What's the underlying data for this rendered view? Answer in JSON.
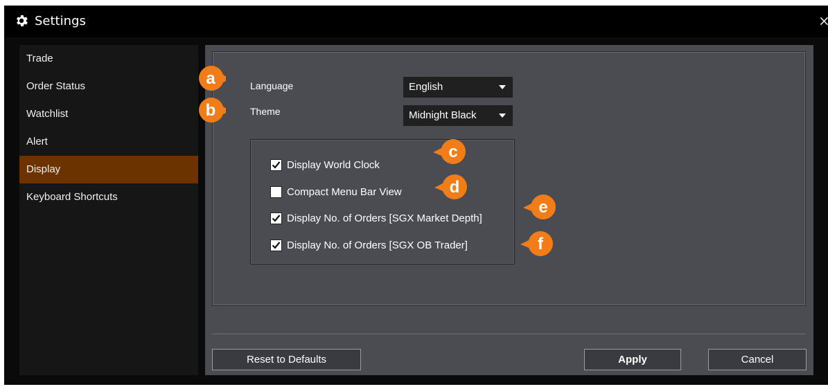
{
  "window": {
    "title": "Settings",
    "close_glyph": "×"
  },
  "sidebar": {
    "items": [
      {
        "label": "Trade"
      },
      {
        "label": "Order Status"
      },
      {
        "label": "Watchlist"
      },
      {
        "label": "Alert"
      },
      {
        "label": "Display",
        "active": true
      },
      {
        "label": "Keyboard Shortcuts"
      }
    ]
  },
  "display": {
    "language": {
      "label": "Language",
      "value": "English"
    },
    "theme": {
      "label": "Theme",
      "value": "Midnight Black"
    },
    "options": [
      {
        "label": "Display World Clock",
        "checked": true
      },
      {
        "label": "Compact Menu Bar View",
        "checked": false
      },
      {
        "label": "Display No. of Orders [SGX Market Depth]",
        "checked": true
      },
      {
        "label": "Display No. of Orders [SGX OB Trader]",
        "checked": true
      }
    ]
  },
  "buttons": {
    "reset": "Reset to Defaults",
    "apply": "Apply",
    "cancel": "Cancel"
  },
  "callouts": [
    "a",
    "b",
    "c",
    "d",
    "e",
    "f"
  ],
  "colors": {
    "accent_orange": "#f07d18",
    "active_item": "#6a3300",
    "panel_bg": "#4a4c52"
  },
  "icons": {
    "title": "gear-icon",
    "dropdown": "caret-down-icon",
    "checkbox": "checkmark-icon"
  }
}
